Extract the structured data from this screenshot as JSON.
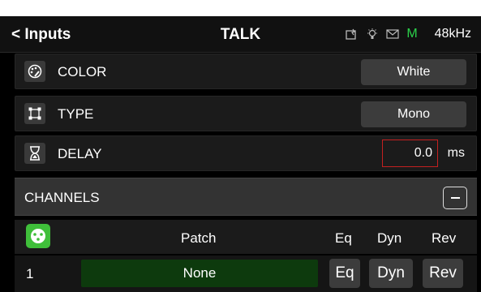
{
  "header": {
    "back_label": "< Inputs",
    "title": "TALK",
    "status_letter": "M",
    "sample_rate": "48kHz"
  },
  "settings": {
    "color": {
      "label": "COLOR",
      "value": "White",
      "icon": "palette-icon"
    },
    "type": {
      "label": "TYPE",
      "value": "Mono",
      "icon": "frame-icon"
    },
    "delay": {
      "label": "DELAY",
      "value": "0.0",
      "unit": "ms",
      "icon": "hourglass-icon"
    }
  },
  "channels": {
    "label": "CHANNELS",
    "columns": {
      "patch": "Patch",
      "eq": "Eq",
      "dyn": "Dyn",
      "rev": "Rev"
    },
    "rows": [
      {
        "number": "1",
        "patch": "None",
        "eq": "Eq",
        "dyn": "Dyn",
        "rev": "Rev"
      }
    ]
  },
  "colors": {
    "status_green": "#2bd14a",
    "patch_bg": "#0d3a0d",
    "delay_border": "#c42020",
    "xlr_green": "#3fbf3a"
  }
}
